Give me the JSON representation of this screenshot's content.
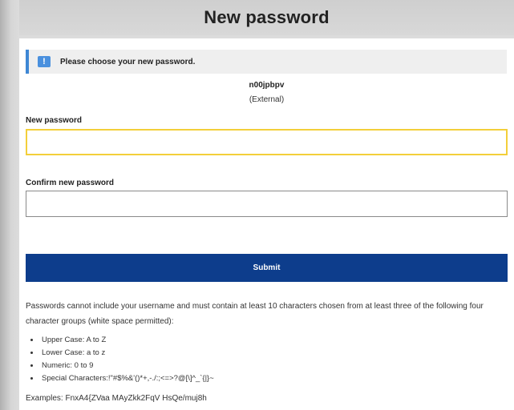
{
  "header": {
    "title": "New password"
  },
  "notice": {
    "icon": "info-icon",
    "icon_glyph": "!",
    "text": "Please choose your new password.",
    "accent_color": "#3e87d4"
  },
  "user": {
    "username": "n00jpbpv",
    "type": "(External)"
  },
  "form": {
    "new_password_label": "New password",
    "new_password_value": "",
    "confirm_password_label": "Confirm new password",
    "confirm_password_value": "",
    "submit_label": "Submit",
    "submit_color": "#0d3d8c",
    "focus_color": "#f3cf3a"
  },
  "rules": {
    "intro": "Passwords cannot include your username and must contain at least 10 characters chosen from at least three of the following four character groups (white space permitted):",
    "items": [
      "Upper Case: A to Z",
      "Lower Case: a to z",
      "Numeric: 0 to 9",
      "Special Characters:!\"#$%&'()*+,-./:;<=>?@[\\]^_`{|}~"
    ],
    "examples": "Examples: FnxA4{ZVaa MAyZkk2FqV HsQe/muj8h"
  }
}
